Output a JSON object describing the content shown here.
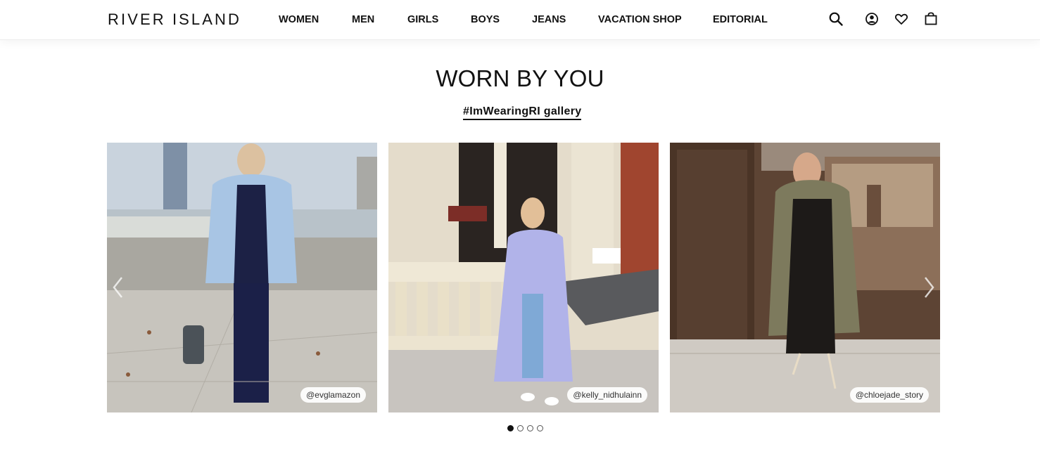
{
  "header": {
    "logo": "RIVER ISLAND",
    "nav": [
      {
        "label": "WOMEN"
      },
      {
        "label": "MEN"
      },
      {
        "label": "GIRLS"
      },
      {
        "label": "BOYS"
      },
      {
        "label": "JEANS"
      },
      {
        "label": "VACATION SHOP"
      },
      {
        "label": "EDITORIAL"
      }
    ],
    "icons": [
      "search-icon",
      "account-icon",
      "heart-icon",
      "bag-icon"
    ]
  },
  "section": {
    "title": "WORN BY YOU",
    "gallery_link": "#ImWearingRI gallery"
  },
  "carousel": {
    "cards": [
      {
        "handle": "@evglamazon"
      },
      {
        "handle": "@kelly_nidhulainn"
      },
      {
        "handle": "@chloejade_story"
      }
    ],
    "dots": 4,
    "active_dot": 0
  },
  "colors": {
    "text": "#111111",
    "background": "#ffffff"
  }
}
